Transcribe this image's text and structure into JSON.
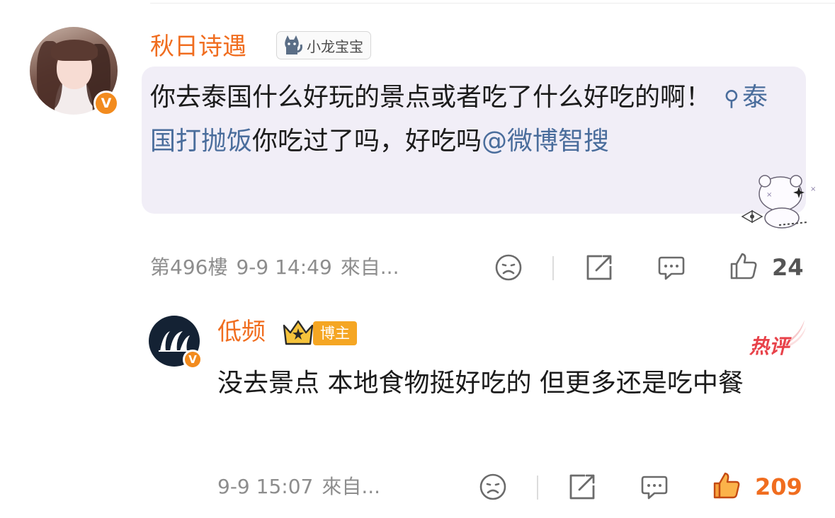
{
  "main_comment": {
    "username": "秋日诗遇",
    "tag": "小龙宝宝",
    "verified_badge": "V",
    "text_before": "你去泰国什么好玩的景点或者吃了什么好吃的啊！",
    "topic": "泰国打抛饭",
    "text_middle": "你吃过了吗，好吃吗",
    "mention": "@微博智搜",
    "floor": "第496樓",
    "time": "9-9 14:49",
    "source": "來自...",
    "like_count": "24",
    "icons": [
      "sad-face-icon",
      "share-icon",
      "comment-icon",
      "thumbs-up-icon"
    ]
  },
  "reply": {
    "username": "低频",
    "host_badge": "博主",
    "hot_badge": "热评",
    "verified_badge": "V",
    "text": "没去景点 本地食物挺好吃的 但更多还是吃中餐",
    "time": "9-9 15:07",
    "source": "來自...",
    "like_count": "209",
    "icons": [
      "sad-face-icon",
      "share-icon",
      "comment-icon",
      "thumbs-up-filled-icon"
    ]
  },
  "colors": {
    "username": "#f06d1f",
    "link": "#4a6d9c",
    "bubble": "#f1eef7",
    "meta": "#8d8d8d",
    "liked": "#f06d1f",
    "hot": "#e8424a"
  }
}
